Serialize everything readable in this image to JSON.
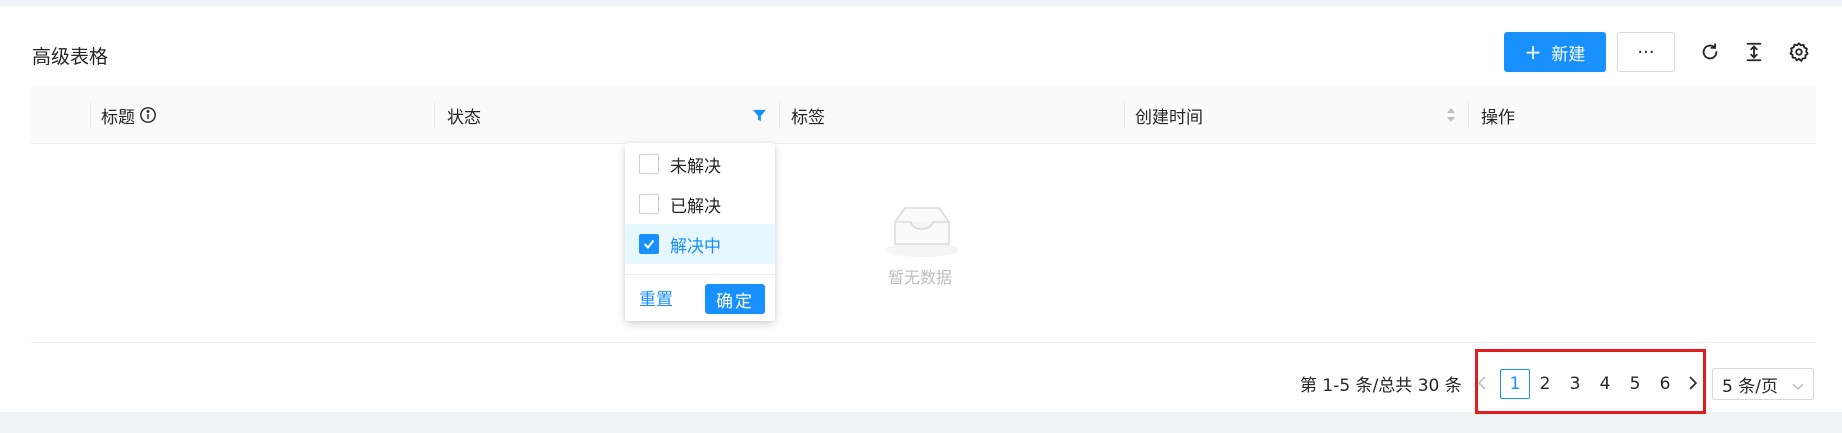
{
  "page": {
    "title": "高级表格"
  },
  "toolbar": {
    "new_label": "新建",
    "more_label": "···",
    "icons": [
      "reload-icon",
      "column-height-icon",
      "setting-icon"
    ]
  },
  "table": {
    "columns": [
      {
        "label": "标题",
        "icon": "info-circle-icon"
      },
      {
        "label": "状态",
        "icon": "filter-icon"
      },
      {
        "label": "标签"
      },
      {
        "label": "创建时间",
        "icon": "sort-icon"
      },
      {
        "label": "操作"
      }
    ],
    "empty_text": "暂无数据"
  },
  "filter_dropdown": {
    "options": [
      {
        "label": "未解决",
        "checked": false
      },
      {
        "label": "已解决",
        "checked": false
      },
      {
        "label": "解决中",
        "checked": true
      }
    ],
    "reset_label": "重置",
    "ok_label": "确定"
  },
  "pagination": {
    "total_text": "第 1-5 条/总共 30 条",
    "pages": [
      "1",
      "2",
      "3",
      "4",
      "5",
      "6"
    ],
    "current": "1",
    "page_size_label": "5 条/页"
  },
  "colors": {
    "primary": "#1890ff",
    "highlight": "#e11d1d"
  }
}
